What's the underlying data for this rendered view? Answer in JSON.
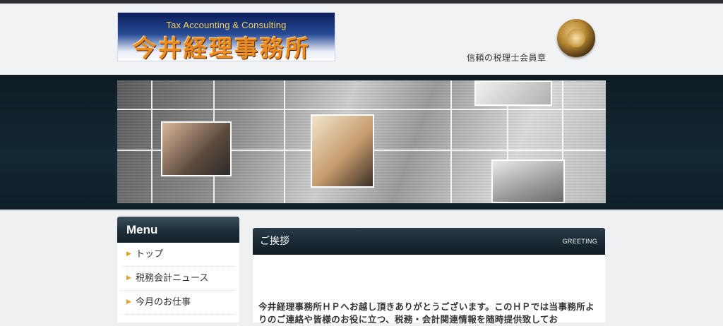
{
  "header": {
    "logo_subtitle": "Tax Accounting & Consulting",
    "logo_title": "今井経理事務所",
    "seal_caption": "信頼の税理士会員章"
  },
  "sidebar": {
    "title": "Menu",
    "items": [
      {
        "label": "トップ"
      },
      {
        "label": "税務会計ニュース"
      },
      {
        "label": "今月のお仕事"
      }
    ]
  },
  "greeting": {
    "title": "ご挨拶",
    "label": "GREETING",
    "text": "今井経理事務所ＨＰへお越し頂きありがとうございます。このＨＰでは当事務所よりのご連絡や皆様のお役に立つ、税務・会計関連情報を随時提供致してお"
  },
  "colors": {
    "header_bg": "#f1f2f4",
    "banner_band": "#132833",
    "accent_arrow": "#e3a22a",
    "logo_text": "#e98b23"
  },
  "icons": {
    "menu_bullet": "triangle-right-icon"
  }
}
